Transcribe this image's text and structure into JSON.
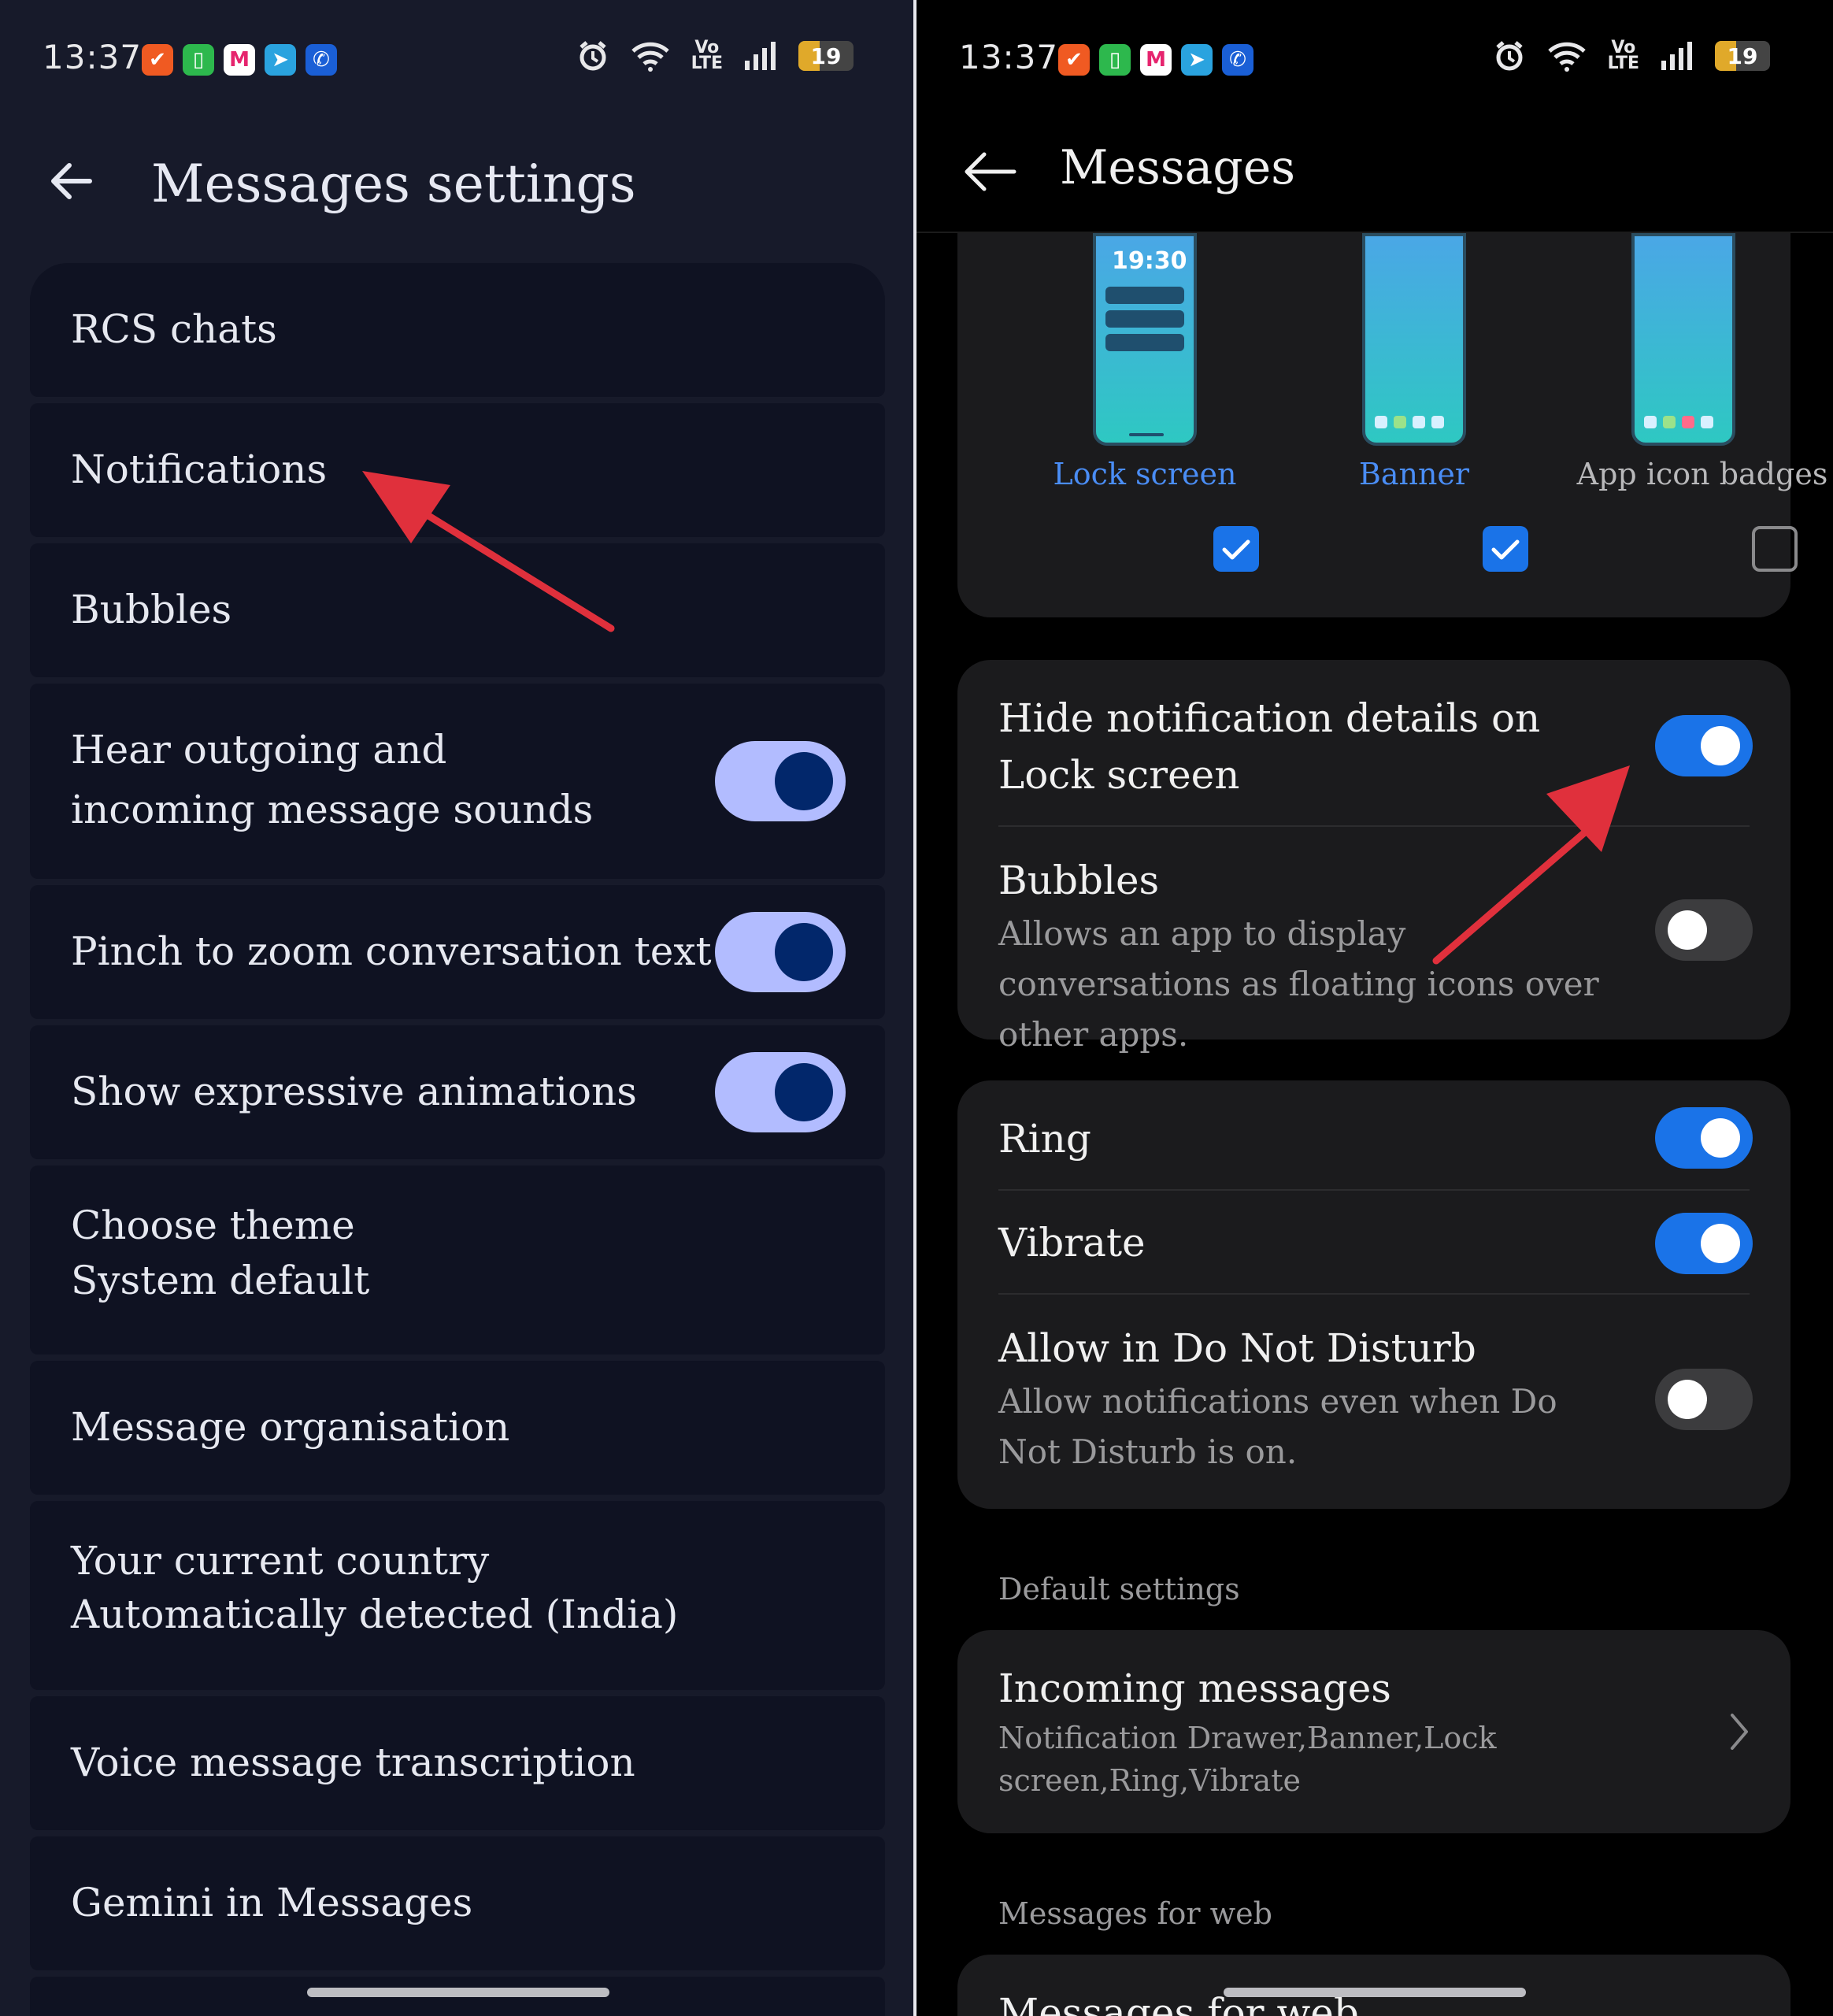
{
  "status": {
    "time": "13:37",
    "battery": "19",
    "volte_top": "Vo",
    "volte_bottom": "LTE"
  },
  "left": {
    "title": "Messages settings",
    "items": [
      {
        "label": "RCS chats"
      },
      {
        "label": "Notifications"
      },
      {
        "label": "Bubbles"
      },
      {
        "label": "Hear outgoing and incoming message sounds",
        "toggle": true
      },
      {
        "label": "Pinch to zoom conversation text",
        "toggle": true
      },
      {
        "label": "Show expressive animations",
        "toggle": true
      },
      {
        "label": "Choose theme",
        "sub": "System default"
      },
      {
        "label": "Message organisation"
      },
      {
        "label": "Your current country",
        "sub": "Automatically detected (India)"
      },
      {
        "label": "Voice message transcription"
      },
      {
        "label": "Gemini in Messages"
      }
    ]
  },
  "right": {
    "title": "Messages",
    "styles": [
      {
        "label": "Lock screen",
        "checked": true,
        "phone_time": "19:30"
      },
      {
        "label": "Banner",
        "checked": true
      },
      {
        "label": "App icon badges",
        "checked": false
      }
    ],
    "hide_details": {
      "title": "Hide notification details on Lock screen",
      "on": true
    },
    "bubbles": {
      "title": "Bubbles",
      "sub": "Allows an app to display conversations as floating icons over other apps.",
      "on": false
    },
    "ring": {
      "title": "Ring",
      "on": true
    },
    "vibrate": {
      "title": "Vibrate",
      "on": true
    },
    "dnd": {
      "title": "Allow in Do Not Disturb",
      "sub": "Allow notifications even when Do Not Disturb is on.",
      "on": false
    },
    "default_settings_header": "Default settings",
    "incoming": {
      "title": "Incoming messages",
      "sub": "Notification Drawer,Banner,Lock screen,Ring,Vibrate"
    },
    "web_header": "Messages for web",
    "web_item": "Messages for web"
  },
  "colors": {
    "accent_blue": "#1a73e8",
    "toggle_light": "#b2bcff",
    "knob_dark": "#02276b",
    "arrow_red": "#e0303c"
  }
}
